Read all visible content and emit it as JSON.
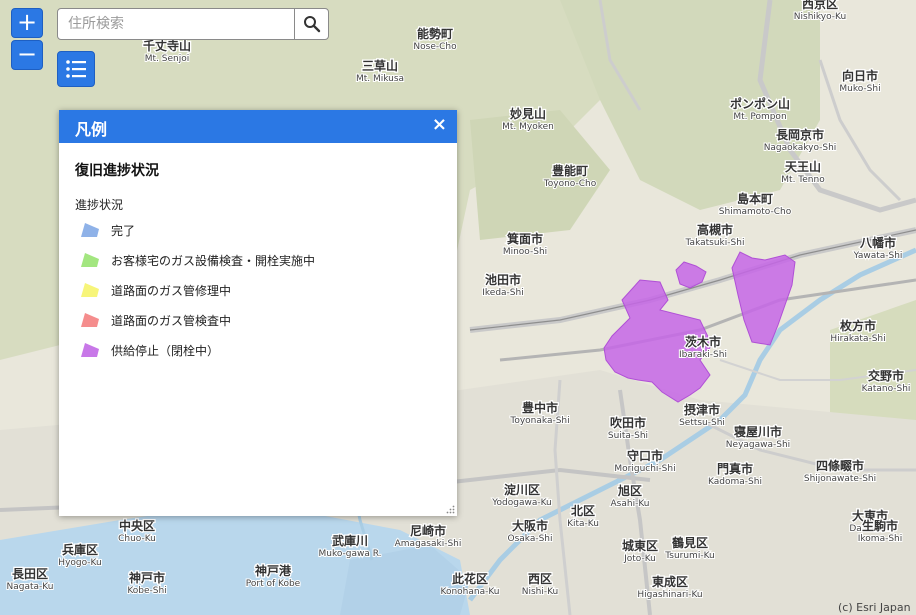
{
  "search": {
    "placeholder": "住所検索"
  },
  "controls": {
    "zoom_in": "+",
    "zoom_out": "−"
  },
  "legend": {
    "title": "凡例",
    "close": "×",
    "heading": "復旧進捗状況",
    "subheading": "進捗状況",
    "items": [
      {
        "label": "完了",
        "color": "#8fb2e8"
      },
      {
        "label": "お客様宅のガス設備検査・開栓実施中",
        "color": "#a3e680"
      },
      {
        "label": "道路面のガス管修理中",
        "color": "#f7f57a"
      },
      {
        "label": "道路面のガス管検査中",
        "color": "#f58d8d"
      },
      {
        "label": "供給停止（閉栓中）",
        "color": "#c878e8"
      }
    ]
  },
  "map": {
    "labels": [
      {
        "ja": "能勢町",
        "en": "Nose-Cho"
      },
      {
        "ja": "千丈寺山",
        "en": "Mt. Senjoi"
      },
      {
        "ja": "三草山",
        "en": "Mt. Mikusa"
      },
      {
        "ja": "妙見山",
        "en": "Mt. Myoken"
      },
      {
        "ja": "豊能町",
        "en": "Toyono-Cho"
      },
      {
        "ja": "箕面市",
        "en": "Minoo-Shi"
      },
      {
        "ja": "池田市",
        "en": "Ikeda-Shi"
      },
      {
        "ja": "高槻市",
        "en": "Takatsuki-Shi"
      },
      {
        "ja": "茨木市",
        "en": "Ibaraki-Shi"
      },
      {
        "ja": "摂津市",
        "en": "Settsu-Shi"
      },
      {
        "ja": "吹田市",
        "en": "Suita-Shi"
      },
      {
        "ja": "豊中市",
        "en": "Toyonaka-Shi"
      },
      {
        "ja": "島本町",
        "en": "Shimamoto-Cho"
      },
      {
        "ja": "長岡京市",
        "en": "Nagaokakyo-Shi"
      },
      {
        "ja": "向日市",
        "en": "Muko-Shi"
      },
      {
        "ja": "西京区",
        "en": "Nishikyo-Ku"
      },
      {
        "ja": "八幡市",
        "en": "Yawata-Shi"
      },
      {
        "ja": "枚方市",
        "en": "Hirakata-Shi"
      },
      {
        "ja": "交野市",
        "en": "Katano-Shi"
      },
      {
        "ja": "寝屋川市",
        "en": "Neyagawa-Shi"
      },
      {
        "ja": "守口市",
        "en": "Moriguchi-Shi"
      },
      {
        "ja": "門真市",
        "en": "Kadoma-Shi"
      },
      {
        "ja": "四條畷市",
        "en": "Shijonawate-Shi"
      },
      {
        "ja": "淀川区",
        "en": "Yodogawa-Ku"
      },
      {
        "ja": "北区",
        "en": "Kita-Ku"
      },
      {
        "ja": "旭区",
        "en": "Asahi-Ku"
      },
      {
        "ja": "大阪市",
        "en": "Osaka-Shi"
      },
      {
        "ja": "尼崎市",
        "en": "Amagasaki-Shi"
      },
      {
        "ja": "中央区",
        "en": "Chuo-Ku"
      },
      {
        "ja": "兵庫区",
        "en": "Hyogo-Ku"
      },
      {
        "ja": "神戸市",
        "en": "Kobe-Shi"
      },
      {
        "ja": "神戸港",
        "en": "Port of Kobe"
      },
      {
        "ja": "長田区",
        "en": "Nagata-Ku"
      },
      {
        "ja": "鶴見区",
        "en": "Tsurumi-Ku"
      },
      {
        "ja": "城東区",
        "en": "Joto-Ku"
      },
      {
        "ja": "大東市",
        "en": "Daito-Shi"
      },
      {
        "ja": "生駒市",
        "en": "Ikoma-Shi"
      },
      {
        "ja": "西区",
        "en": "Nishi-Ku"
      },
      {
        "ja": "此花区",
        "en": "Konohana-Ku"
      },
      {
        "ja": "東成区",
        "en": "Higashinari-Ku"
      },
      {
        "ja": "武庫川",
        "en": "Muko-gawa R."
      },
      {
        "ja": "ポンポン山",
        "en": "Mt. Pompon"
      },
      {
        "ja": "天王山",
        "en": "Mt. Tenno"
      }
    ],
    "attribution": "(c) Esri Japan"
  }
}
